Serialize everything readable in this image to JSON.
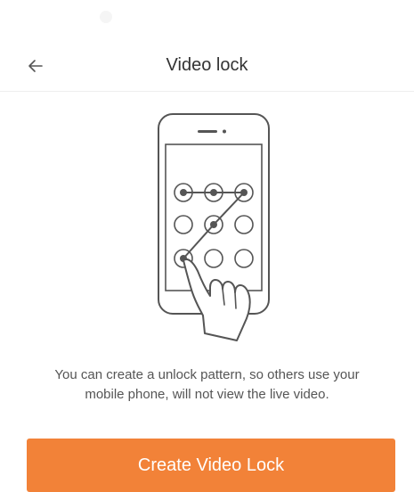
{
  "header": {
    "title": "Video lock",
    "back_icon": "arrow-left-icon"
  },
  "illustration": {
    "icon": "phone-unlock-pattern-icon"
  },
  "description": {
    "line1": "You can create a unlock pattern, so others use your",
    "line2": "mobile phone, will not view the live video."
  },
  "primary_action": {
    "label": "Create Video Lock"
  },
  "colors": {
    "accent": "#f28238",
    "divider": "#eeeeee",
    "illustration_stroke": "#555555"
  }
}
